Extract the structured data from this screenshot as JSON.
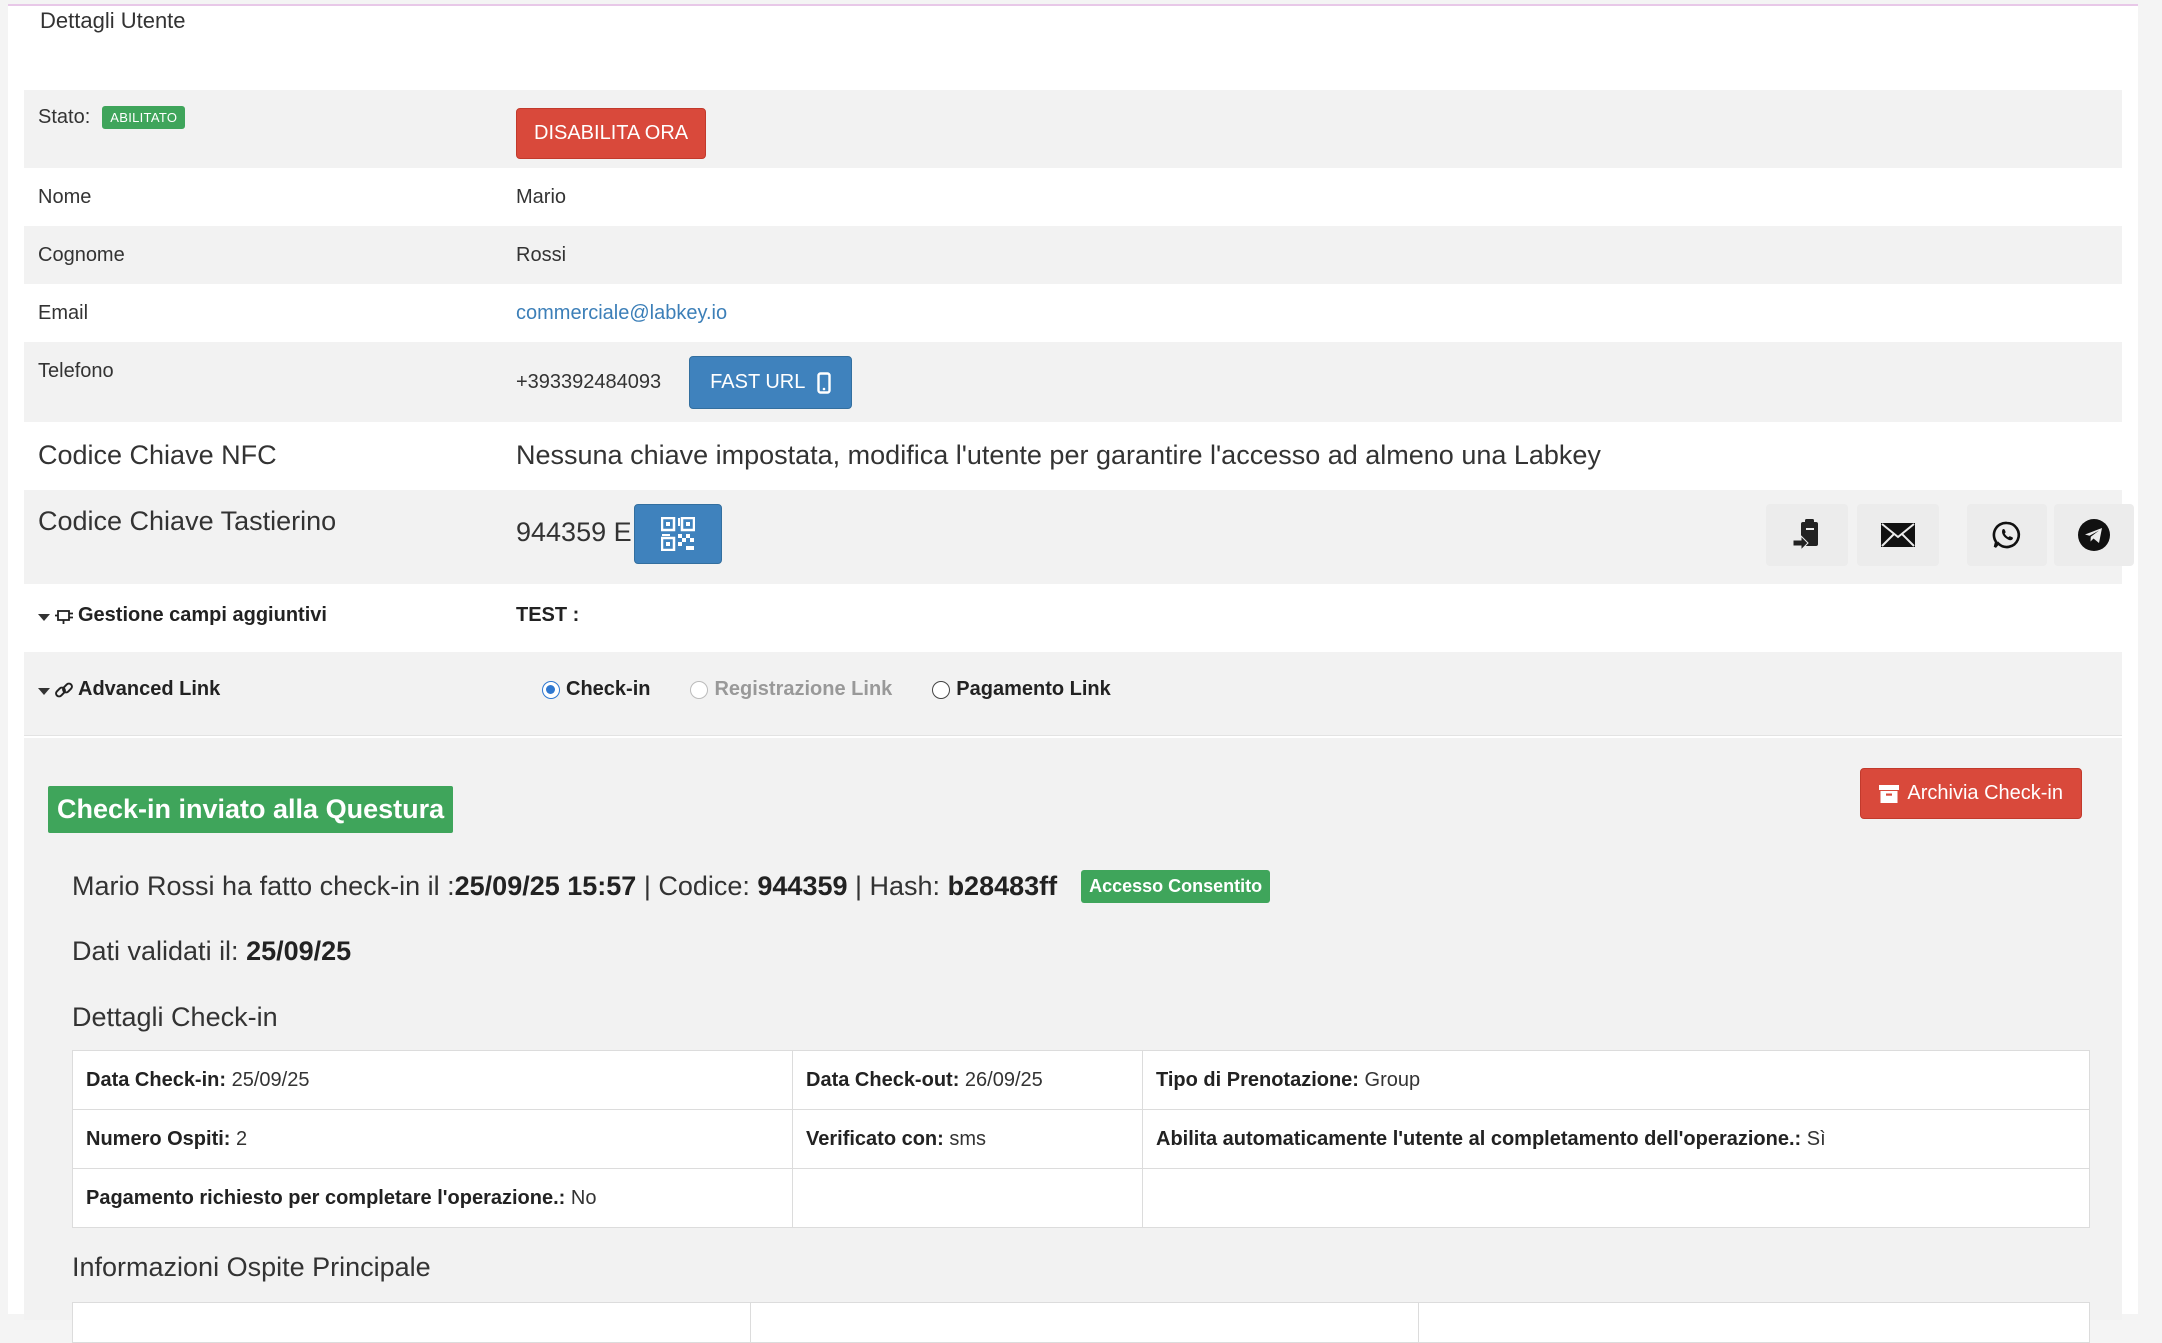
{
  "page": {
    "title": "Dettagli Utente"
  },
  "stato": {
    "label": "Stato:",
    "badge": "ABILITATO",
    "button": "DISABILITA ORA"
  },
  "nome": {
    "label": "Nome",
    "value": "Mario"
  },
  "cognome": {
    "label": "Cognome",
    "value": "Rossi"
  },
  "email": {
    "label": "Email",
    "value": "commerciale@labkey.io"
  },
  "telefono": {
    "label": "Telefono",
    "value": "+393392484093",
    "button": "FAST URL",
    "button_icon": "mobile-icon"
  },
  "nfc": {
    "label": "Codice Chiave NFC",
    "value": "Nessuna chiave impostata, modifica l'utente per garantire l'accesso ad almeno una Labkey"
  },
  "tastierino": {
    "label": "Codice Chiave Tastierino",
    "value": "944359 E",
    "qr_icon": "qr-code-icon",
    "share_icons": [
      "clipboard-icon",
      "envelope-icon",
      "whatsapp-icon",
      "telegram-icon"
    ]
  },
  "gestione": {
    "label": "Gestione campi aggiuntivi",
    "icon": "plug-icon",
    "value": "TEST :"
  },
  "advanced": {
    "label": "Advanced Link",
    "icon": "link-icon",
    "options": [
      {
        "label": "Check-in",
        "selected": true,
        "disabled": false
      },
      {
        "label": "Registrazione Link",
        "selected": false,
        "disabled": true
      },
      {
        "label": "Pagamento Link",
        "selected": false,
        "disabled": false
      }
    ]
  },
  "checkin": {
    "title": "Check-in inviato alla Questura",
    "archive_button": "Archivia Check-in",
    "summary_prefix": "Mario Rossi ha fatto check-in il : ",
    "summary_date": "25/09/25 15:57",
    "code_label": " | Codice: ",
    "code": "944359",
    "hash_label": " | Hash: ",
    "hash": "b28483ff",
    "access_badge": "Accesso Consentito",
    "validated_label": "Dati validati il: ",
    "validated_date": "25/09/25",
    "details_title": "Dettagli Check-in",
    "details": [
      [
        {
          "label": "Data Check-in:",
          "value": "25/09/25"
        },
        {
          "label": "Data Check-out:",
          "value": "26/09/25"
        },
        {
          "label": "Tipo di Prenotazione:",
          "value": "Group"
        }
      ],
      [
        {
          "label": "Numero Ospiti:",
          "value": "2"
        },
        {
          "label": "Verificato con:",
          "value": "sms"
        },
        {
          "label": "Abilita automaticamente l'utente al completamento dell'operazione.:",
          "value": "Sì"
        }
      ],
      [
        {
          "label": "Pagamento richiesto per completare l'operazione.:",
          "value": "No"
        },
        {
          "label": "",
          "value": ""
        },
        {
          "label": "",
          "value": ""
        }
      ]
    ],
    "guest_title": "Informazioni Ospite Principale"
  },
  "colors": {
    "success": "#3fa55b",
    "danger": "#d9493b",
    "primary": "#3f82bd",
    "link": "#3c7fb8"
  }
}
